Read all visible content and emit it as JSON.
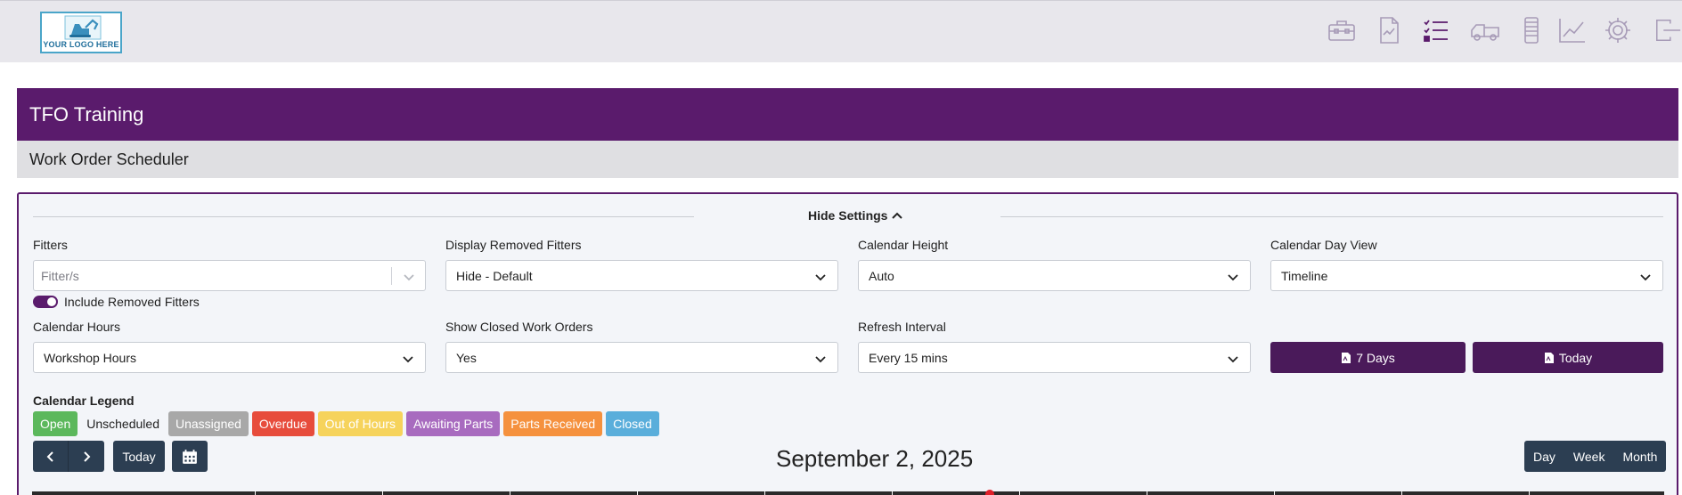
{
  "header": {
    "logo_text": "YOUR LOGO HERE",
    "nav_icons": [
      "toolbox-icon",
      "document-icon",
      "checklist-icon",
      "truck-icon",
      "device-icon",
      "chart-icon",
      "gear-icon",
      "logout-icon"
    ]
  },
  "page": {
    "title": "TFO Training",
    "subtitle": "Work Order Scheduler"
  },
  "settings": {
    "hide_label": "Hide Settings",
    "fitters_label": "Fitters",
    "fitters_placeholder": "Fitter/s",
    "include_removed_label": "Include Removed Fitters",
    "include_removed_on": true,
    "display_removed_label": "Display Removed Fitters",
    "display_removed_value": "Hide - Default",
    "calendar_height_label": "Calendar Height",
    "calendar_height_value": "Auto",
    "day_view_label": "Calendar Day View",
    "day_view_value": "Timeline",
    "calendar_hours_label": "Calendar Hours",
    "calendar_hours_value": "Workshop Hours",
    "show_closed_label": "Show Closed Work Orders",
    "show_closed_value": "Yes",
    "refresh_label": "Refresh Interval",
    "refresh_value": "Every 15 mins",
    "btn_7days": "7 Days",
    "btn_today_pdf": "Today"
  },
  "legend": {
    "title": "Calendar Legend",
    "items": [
      {
        "label": "Open",
        "color": "#5cb85c"
      },
      {
        "label": "Unscheduled",
        "color": ""
      },
      {
        "label": "Unassigned",
        "color": "#a8a8a8"
      },
      {
        "label": "Overdue",
        "color": "#e74c3c"
      },
      {
        "label": "Out of Hours",
        "color": "#f6d35c"
      },
      {
        "label": "Awaiting Parts",
        "color": "#a86bbf"
      },
      {
        "label": "Parts Received",
        "color": "#f5913e"
      },
      {
        "label": "Closed",
        "color": "#5aaedb"
      }
    ]
  },
  "calendar": {
    "date": "September 2, 2025",
    "today_label": "Today",
    "views": [
      "Day",
      "Week",
      "Month"
    ]
  }
}
